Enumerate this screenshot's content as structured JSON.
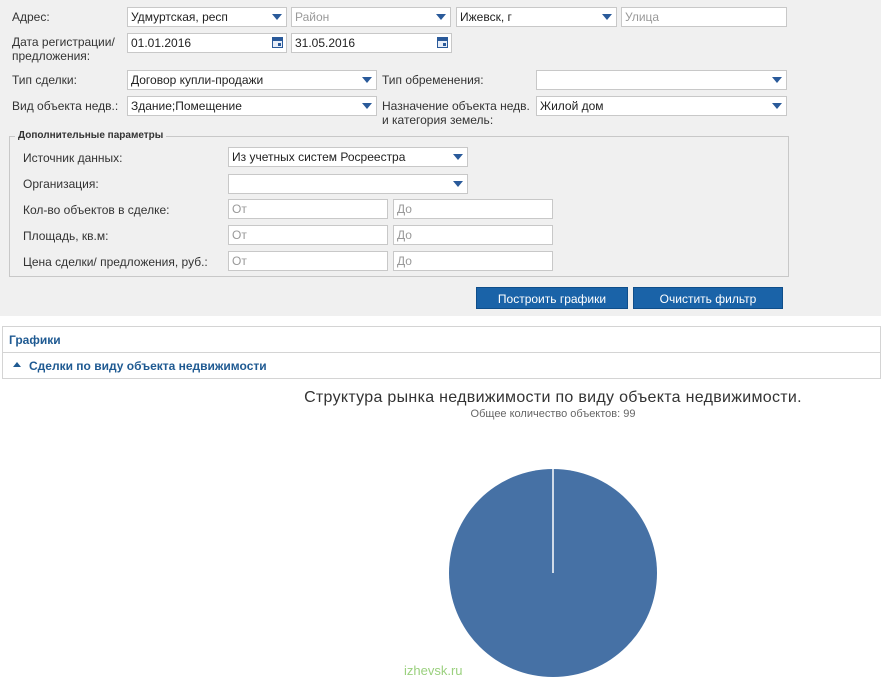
{
  "filters": {
    "address": {
      "label": "Адрес:",
      "region": "Удмуртская, респ",
      "district_placeholder": "Район",
      "city": "Ижевск, г",
      "street_placeholder": "Улица"
    },
    "reg_date": {
      "label_line1": "Дата регистрации/",
      "label_line2": "предложения:",
      "from": "01.01.2016",
      "to": "31.05.2016"
    },
    "deal_type": {
      "label": "Тип сделки:",
      "value": "Договор купли-продажи"
    },
    "encumbrance_type": {
      "label": "Тип обременения:",
      "value": ""
    },
    "object_type": {
      "label": "Вид объекта недв.:",
      "value": "Здание;Помещение"
    },
    "purpose": {
      "label_line1": "Назначение объекта недв.",
      "label_line2": "и категория земель:",
      "value": "Жилой дом"
    },
    "extra": {
      "legend": "Дополнительные параметры",
      "source": {
        "label": "Источник данных:",
        "value": "Из учетных систем Росреестра"
      },
      "organization": {
        "label": "Организация:",
        "value": ""
      },
      "object_count": {
        "label": "Кол-во объектов в сделке:",
        "from_ph": "От",
        "to_ph": "До"
      },
      "area": {
        "label": "Площадь, кв.м:",
        "from_ph": "От",
        "to_ph": "До"
      },
      "price": {
        "label": "Цена сделки/ предложения, руб.:",
        "from_ph": "От",
        "to_ph": "До"
      }
    },
    "build_button": "Построить графики",
    "clear_button": "Очистить фильтр"
  },
  "charts_section": {
    "title": "Графики",
    "subsection": "Сделки по виду объекта недвижимости"
  },
  "watermark": "izhevsk.ru",
  "colors": {
    "accent": "#1a63a8",
    "pie": "#4671a5"
  },
  "chart_data": {
    "type": "pie",
    "title": "Структура рынка недвижимости по виду объекта недвижимости.",
    "subtitle": "Общее количество объектов: 99",
    "slices": [
      {
        "name": "",
        "value": 99
      }
    ]
  }
}
